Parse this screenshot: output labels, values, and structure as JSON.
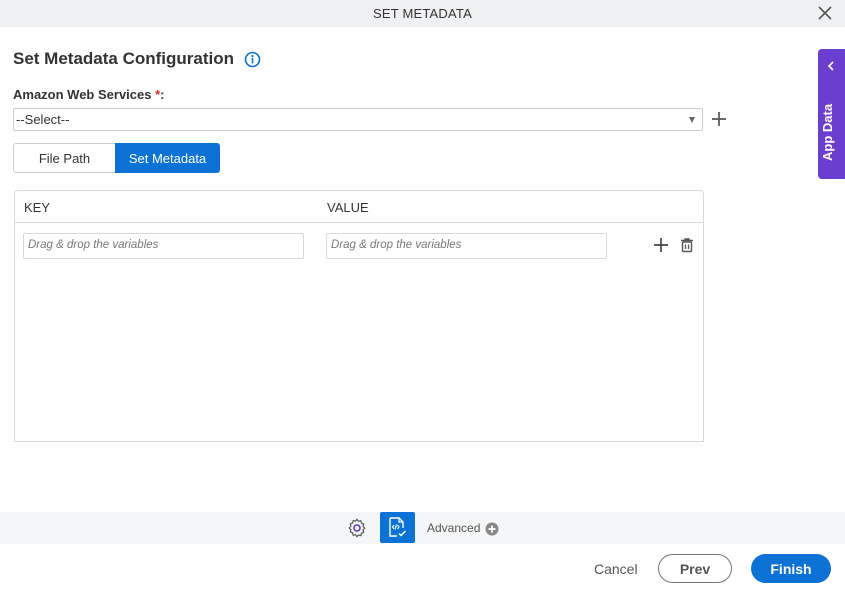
{
  "dialog": {
    "title": "SET METADATA",
    "close_icon": "close-icon"
  },
  "form": {
    "heading": "Set Metadata Configuration",
    "info_icon": "info-icon",
    "aws": {
      "label": "Amazon Web Services",
      "required_marker": "*",
      "colon": ":",
      "selected": "--Select--",
      "add_icon": "plus-icon"
    },
    "tabs": [
      {
        "label": "File Path",
        "active": false
      },
      {
        "label": "Set Metadata",
        "active": true
      }
    ],
    "grid": {
      "columns": [
        "KEY",
        "VALUE"
      ],
      "rows": [
        {
          "key_placeholder": "Drag & drop the variables",
          "value_placeholder": "Drag & drop the variables"
        }
      ]
    }
  },
  "side_panel": {
    "label": "App Data",
    "icon": "chevron-left-icon"
  },
  "toolbar": {
    "advanced_label": "Advanced"
  },
  "footer": {
    "cancel": "Cancel",
    "prev": "Prev",
    "finish": "Finish"
  },
  "colors": {
    "primary": "#0c72d6",
    "app_data": "#6a3fd0",
    "required": "#d32f2f"
  }
}
